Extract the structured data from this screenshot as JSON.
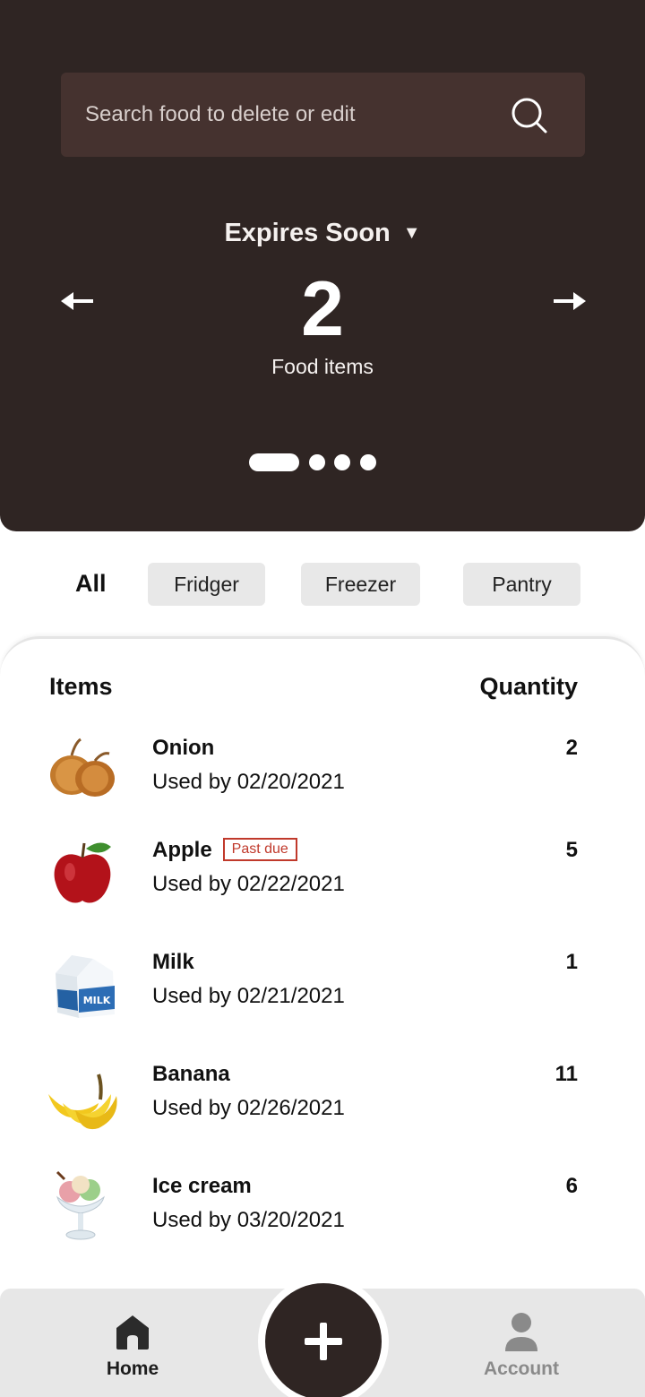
{
  "search": {
    "placeholder": "Search food to delete or edit"
  },
  "summary": {
    "period": "Expires Soon",
    "count": "2",
    "count_label": "Food items"
  },
  "carousel": {
    "pages": 4,
    "active_page": 1
  },
  "filters": {
    "all": "All",
    "chips": [
      "Fridger",
      "Freezer",
      "Pantry"
    ]
  },
  "list": {
    "header_items": "Items",
    "header_quantity": "Quantity",
    "items": [
      {
        "name": "Onion",
        "date": "Used by 02/20/2021",
        "quantity": "2",
        "badge": "",
        "icon": "onion-icon"
      },
      {
        "name": "Apple",
        "date": "Used by 02/22/2021",
        "quantity": "5",
        "badge": "Past due",
        "icon": "apple-icon"
      },
      {
        "name": "Milk",
        "date": "Used by 02/21/2021",
        "quantity": "1",
        "badge": "",
        "icon": "milk-icon"
      },
      {
        "name": "Banana",
        "date": "Used by 02/26/2021",
        "quantity": "11",
        "badge": "",
        "icon": "banana-icon"
      },
      {
        "name": "Ice cream",
        "date": "Used by 03/20/2021",
        "quantity": "6",
        "badge": "",
        "icon": "ice-cream-icon"
      }
    ]
  },
  "nav": {
    "home": "Home",
    "account": "Account"
  },
  "colors": {
    "hero": "#2f2523",
    "search_bg": "#45322f",
    "badge": "#c0392b",
    "nav_bg": "#e7e7e7"
  }
}
